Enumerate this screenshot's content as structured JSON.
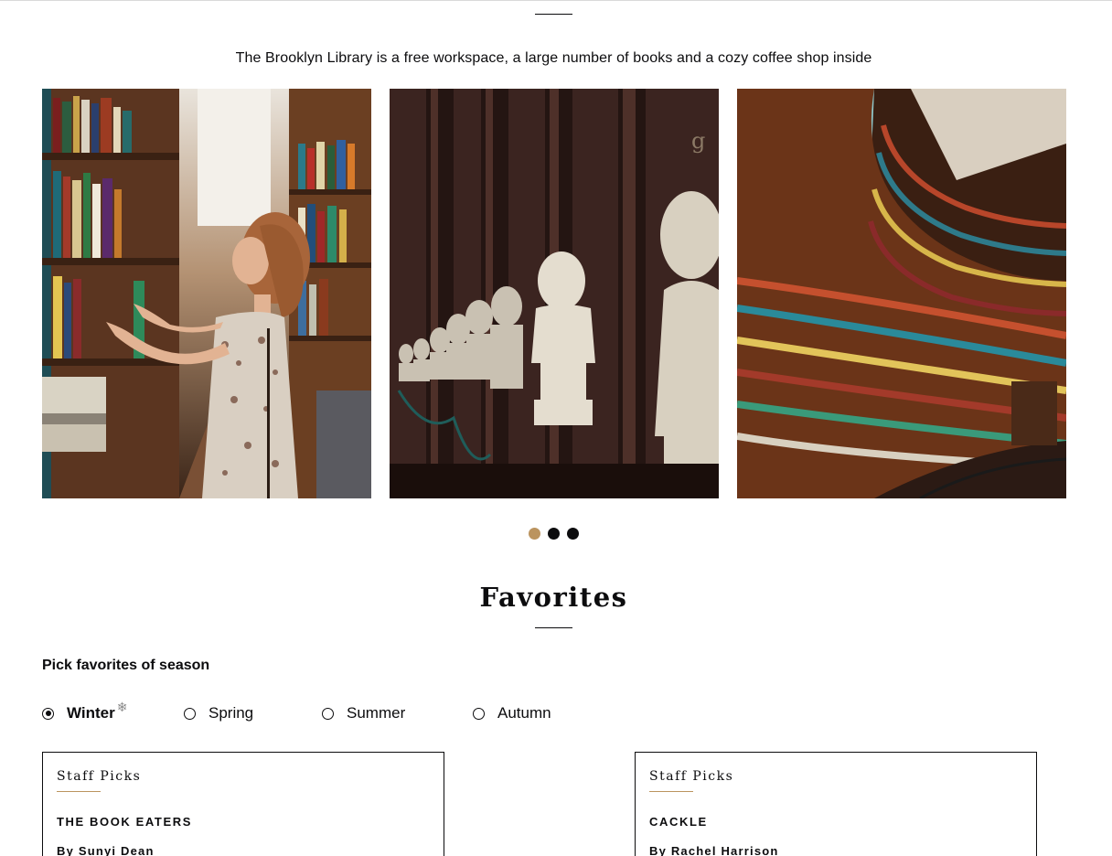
{
  "about": {
    "text": "The Brooklyn Library is a free workspace, a large number of books and a cozy coffee shop inside"
  },
  "slider": {
    "images": [
      {
        "icon": "woman-browsing-bookshelf-photo"
      },
      {
        "icon": "marble-busts-library-photo"
      },
      {
        "icon": "curved-library-bookshelves-photo"
      }
    ],
    "active_dot": 1,
    "dot_count": 3,
    "colors": {
      "active": "#bb945f",
      "inactive": "#0c0c0e"
    }
  },
  "favorites": {
    "title": "Favorites",
    "pick_label": "Pick favorites of season",
    "seasons": [
      {
        "label": "Winter",
        "selected": true,
        "icon": "snowflake-icon"
      },
      {
        "label": "Spring",
        "selected": false
      },
      {
        "label": "Summer",
        "selected": false
      },
      {
        "label": "Autumn",
        "selected": false
      }
    ],
    "cards": [
      {
        "tag": "Staff Picks",
        "title": "THE BOOK EATERS",
        "author": "By Sunyi Dean"
      },
      {
        "tag": "Staff Picks",
        "title": "CACKLE",
        "author": "By Rachel Harrison"
      }
    ]
  }
}
